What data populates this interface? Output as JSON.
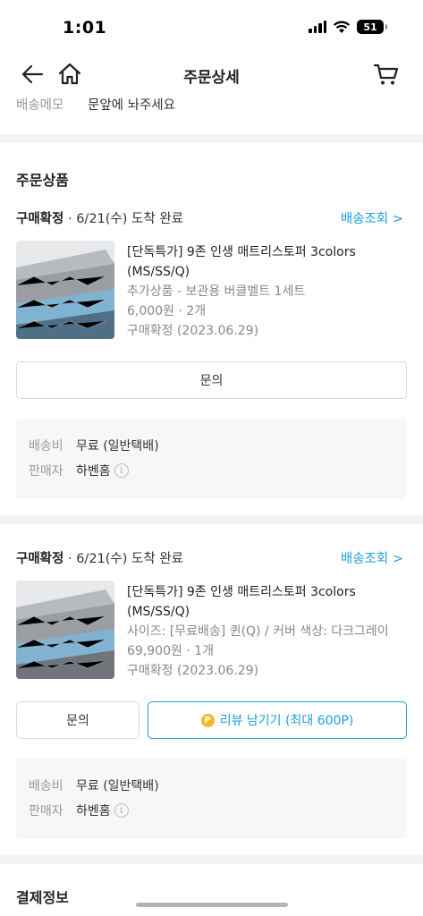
{
  "status_bar": {
    "time": "1:01",
    "battery": "51"
  },
  "header": {
    "title": "주문상세"
  },
  "memo": {
    "label": "배송메모",
    "value": "문앞에 놔주세요"
  },
  "products_section": {
    "title": "주문상품"
  },
  "orders": [
    {
      "status_bold": "구매확정",
      "status_rest": " · 6/21(수) 도착 완료",
      "track_label": "배송조회 >",
      "product_name_line1": "[단독특가] 9존 인생 매트리스토퍼 3colors",
      "product_name_line2": "(MS/SS/Q)",
      "option": "추가상품 - 보관용 버클벨트 1세트",
      "price": "6,000원 · 2개",
      "state": "구매확정 (2023.06.29)",
      "inquiry_label": "문의",
      "shipping_label": "배송비",
      "shipping_value": "무료 (일반택배)",
      "seller_label": "판매자",
      "seller_value": "하벤홈"
    },
    {
      "status_bold": "구매확정",
      "status_rest": " · 6/21(수) 도착 완료",
      "track_label": "배송조회 >",
      "product_name_line1": "[단독특가] 9존 인생 매트리스토퍼 3colors",
      "product_name_line2": "(MS/SS/Q)",
      "option": "사이즈: [무료배송] 퀸(Q) / 커버 색상: 다크그레이",
      "price": "69,900원 · 1개",
      "state": "구매확정 (2023.06.29)",
      "inquiry_label": "문의",
      "review_label": "리뷰 남기기 (최대 600P)",
      "review_coin": "P",
      "shipping_label": "배송비",
      "shipping_value": "무료 (일반택배)",
      "seller_label": "판매자",
      "seller_value": "하벤홈"
    }
  ],
  "payment_section": {
    "title": "결제정보"
  },
  "icons": {
    "back": "arrow-left-icon",
    "home": "home-icon",
    "cart": "cart-icon",
    "info": "info-icon"
  },
  "colors": {
    "accent": "#1a9fe0",
    "coin": "#f6b626",
    "divider": "#f2f3f5"
  }
}
